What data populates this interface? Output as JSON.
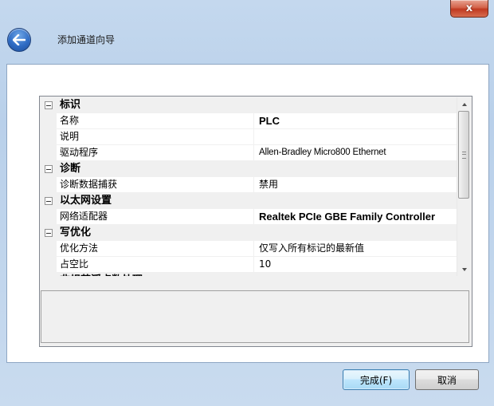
{
  "window": {
    "close_glyph": "x"
  },
  "header": {
    "title": "添加通道向导",
    "back_icon": "back-arrow-icon"
  },
  "property_grid": {
    "rows": [
      {
        "type": "category",
        "label": "标识"
      },
      {
        "type": "property",
        "name": "名称",
        "value": "PLC",
        "bold": true
      },
      {
        "type": "property",
        "name": "说明",
        "value": ""
      },
      {
        "type": "property",
        "name": "驱动程序",
        "value": "Allen-Bradley Micro800 Ethernet"
      },
      {
        "type": "category",
        "label": "诊断"
      },
      {
        "type": "property",
        "name": "诊断数据捕获",
        "value": "禁用"
      },
      {
        "type": "category",
        "label": "以太网设置"
      },
      {
        "type": "property",
        "name": "网络适配器",
        "value": "Realtek PCIe GBE Family Controller",
        "bold": true
      },
      {
        "type": "category",
        "label": "写优化"
      },
      {
        "type": "property",
        "name": "优化方法",
        "value": "仅写入所有标记的最新值"
      },
      {
        "type": "property",
        "name": "占空比",
        "value": "10"
      },
      {
        "type": "category",
        "label": "非规范浮点数处理"
      }
    ]
  },
  "description_panel": {
    "text": ""
  },
  "buttons": {
    "finish_label": "完成(F)",
    "cancel_label": "取消"
  },
  "colors": {
    "close_button": "#c8452b",
    "back_button": "#2f6cc4",
    "primary_button_border": "#3c7fb1",
    "window_frame": "#c4d8ee"
  }
}
